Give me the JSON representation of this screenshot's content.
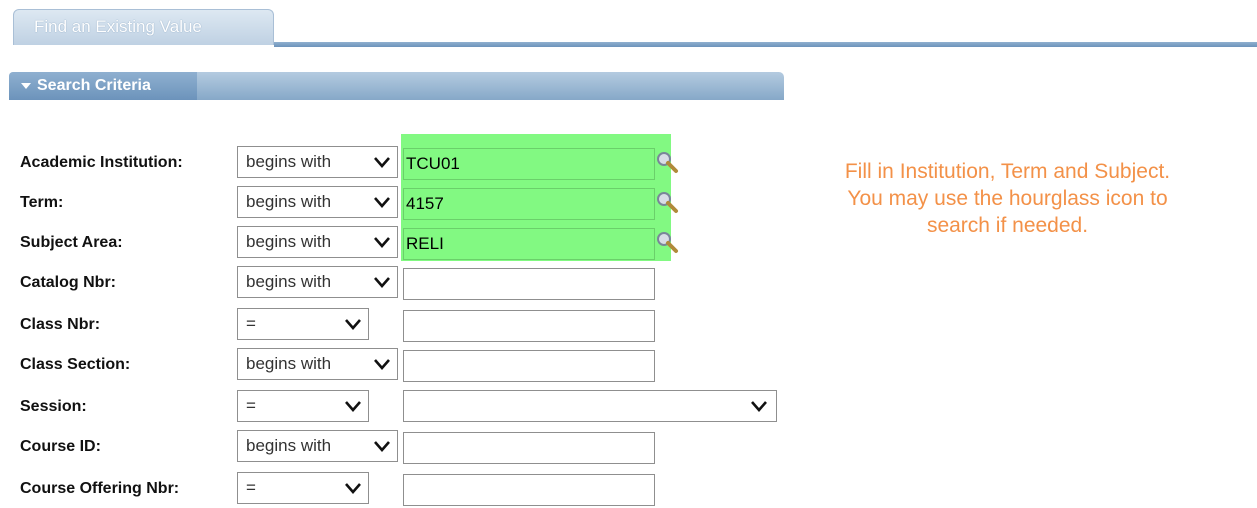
{
  "tab": {
    "label": "Find an Existing Value"
  },
  "section": {
    "title": "Search Criteria"
  },
  "fields": [
    {
      "label": "Academic Institution:",
      "operator": "begins with",
      "value": "TCU01"
    },
    {
      "label": "Term:",
      "operator": "begins with",
      "value": "4157"
    },
    {
      "label": "Subject Area:",
      "operator": "begins with",
      "value": "RELI"
    },
    {
      "label": "Catalog Nbr:",
      "operator": "begins with",
      "value": ""
    },
    {
      "label": "Class Nbr:",
      "operator": "=",
      "value": ""
    },
    {
      "label": "Class Section:",
      "operator": "begins with",
      "value": ""
    },
    {
      "label": "Session:",
      "operator": "=",
      "value": ""
    },
    {
      "label": "Course ID:",
      "operator": "begins with",
      "value": ""
    },
    {
      "label": "Course Offering Nbr:",
      "operator": "=",
      "value": ""
    }
  ],
  "note": {
    "line1": "Fill in Institution, Term and Subject.",
    "line2": "You may use the hourglass icon to",
    "line3": "search if needed."
  },
  "colors": {
    "highlight": "#82f982",
    "note": "#f39148",
    "header": "#6c93bb"
  },
  "icons": {
    "lookup": "magnifier-icon",
    "dropdown": "chevron-down-icon",
    "collapse": "triangle-down-icon"
  }
}
